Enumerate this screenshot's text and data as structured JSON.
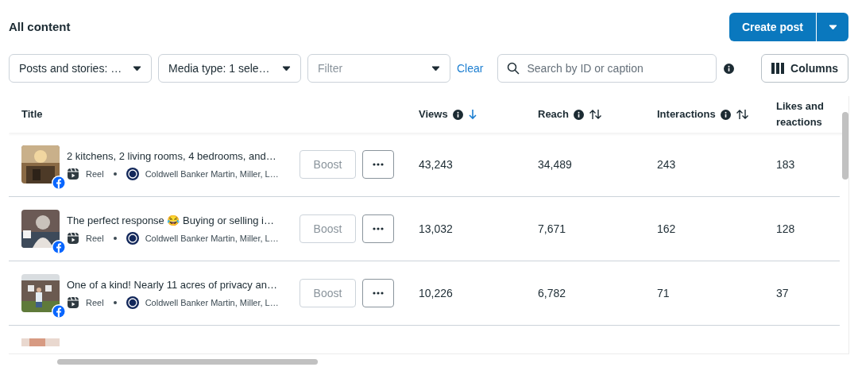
{
  "header": {
    "title": "All content",
    "primary_button": "Create post"
  },
  "filters": [
    {
      "label": "Posts and stories: …"
    },
    {
      "label": "Media type: 1 sele…"
    },
    {
      "placeholder": "Filter"
    }
  ],
  "clear_link": "Clear",
  "search": {
    "placeholder": "Search by ID or caption"
  },
  "columns_button": "Columns",
  "table": {
    "columns": [
      {
        "label": "Title",
        "info": false,
        "sortable": false
      },
      {
        "label": "Views",
        "info": true,
        "sortable": true,
        "sorted": true
      },
      {
        "label": "Reach",
        "info": true,
        "sortable": true,
        "sorted": false
      },
      {
        "label": "Interactions",
        "info": true,
        "sortable": true,
        "sorted": false
      },
      {
        "label": "Likes and reactions",
        "info": false,
        "sortable": false
      }
    ],
    "rows": [
      {
        "caption": "2 kitchens, 2 living rooms, 4 bedrooms, and…",
        "type": "Reel",
        "page": "Coldwell Banker Martin, Miller, L…",
        "boost": "Boost",
        "views": "43,243",
        "reach": "34,489",
        "interactions": "243",
        "likes": "183"
      },
      {
        "caption": "The perfect response 😂 Buying or selling i…",
        "type": "Reel",
        "page": "Coldwell Banker Martin, Miller, L…",
        "boost": "Boost",
        "views": "13,032",
        "reach": "7,671",
        "interactions": "162",
        "likes": "128"
      },
      {
        "caption": "One of a kind! Nearly 11 acres of privacy an…",
        "type": "Reel",
        "page": "Coldwell Banker Martin, Miller, L…",
        "boost": "Boost",
        "views": "10,226",
        "reach": "6,782",
        "interactions": "71",
        "likes": "37"
      }
    ]
  }
}
